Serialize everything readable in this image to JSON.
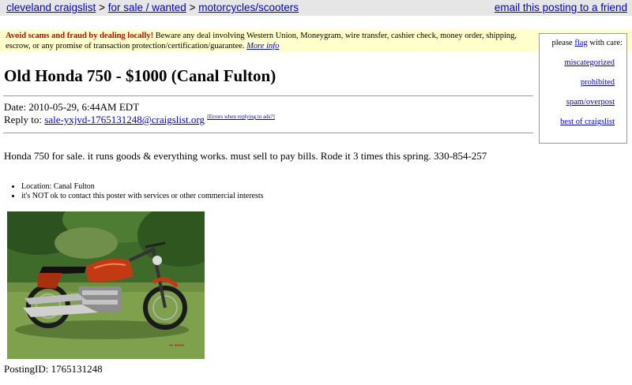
{
  "breadcrumb": {
    "site": "cleveland craigslist",
    "category": "for sale / wanted",
    "subcategory": "motorcycles/scooters",
    "separator": ">"
  },
  "email_link": "email this posting to a friend",
  "warning": {
    "bold": "Avoid scams and fraud by dealing locally!",
    "text": "Beware any deal involving Western Union, Moneygram, wire transfer, cashier check, money order, shipping, escrow, or any promise of transaction protection/certification/guarantee.",
    "more": "More info"
  },
  "flag": {
    "prefix": "please",
    "flag_word": "flag",
    "suffix": "with care:",
    "items": [
      "miscategorized",
      "prohibited",
      "spam/overpost",
      "best of craigslist"
    ]
  },
  "title": "Old Honda 750 - $1000 (Canal Fulton)",
  "date": "Date: 2010-05-29, 6:44AM EDT",
  "reply": {
    "label": "Reply to:",
    "email": "sale-yxjvd-1765131248@craigslist.org",
    "errors": "[Errors when replying to ads?]"
  },
  "body_text": "Honda 750 for sale. it runs goods & everything works. must sell to pay bills. Rode it 3 times this spring. 330-854-257",
  "bullets": [
    "Location: Canal Fulton",
    "it's NOT ok to contact this poster with services or other commercial interests"
  ],
  "posting_id": "PostingID: 1765131248",
  "colors": {
    "link": "#0000cc",
    "warning_bg": "#ffffcc",
    "alert": "#cc0000",
    "topbar_bg": "#e6e6e6"
  }
}
